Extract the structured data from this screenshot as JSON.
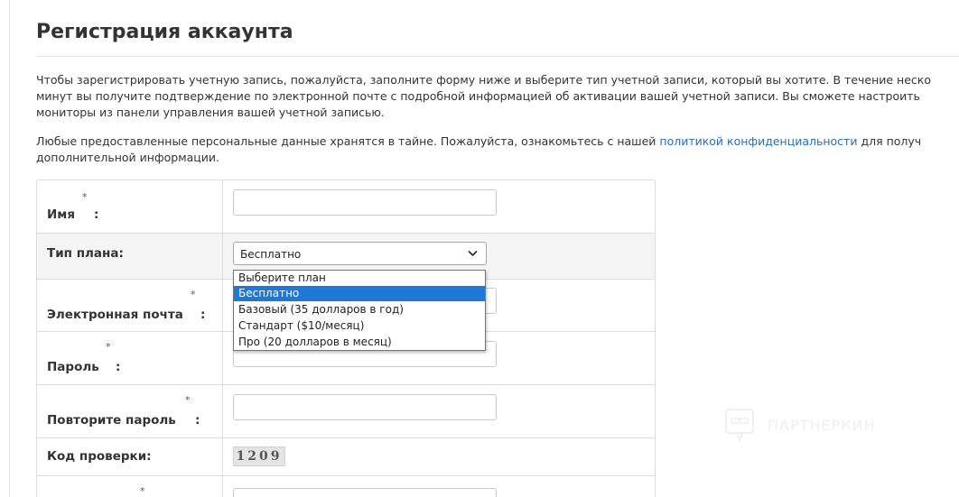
{
  "page": {
    "title": "Регистрация аккаунта",
    "intro_lines": [
      "Чтобы зарегистрировать учетную запись, пожалуйста, заполните форму ниже и выберите тип учетной записи, который вы хотите. В течение неско",
      "минут вы получите подтверждение по электронной почте с подробной информацией об активации вашей учетной записи. Вы сможете настроить",
      "мониторы из панели управления вашей учетной записью."
    ],
    "privacy_before": "Любые предоставленные персональные данные хранятся в тайне. Пожалуйста, ознакомьтесь с нашей ",
    "privacy_link": "политикой конфиденциальности",
    "privacy_after": " для получ",
    "privacy_line2": "дополнительной информации."
  },
  "form": {
    "name_label": "Имя",
    "plan_label": "Тип плана:",
    "email_label": "Электронная почта",
    "password_label": "Пароль",
    "repeat_password_label": "Повторите пароль",
    "captcha_label": "Код проверки:",
    "colon": ":",
    "required_marker": "*",
    "name_value": "",
    "email_value": "",
    "password_value": "",
    "repeat_password_value": "",
    "plan_selected": "Бесплатно",
    "captcha_code": "1209"
  },
  "plan_dropdown": {
    "options": [
      "Выберите план",
      "Бесплатно",
      "Базовый (35 долларов в год)",
      "Стандарт ($10/месяц)",
      "Про (20 долларов в месяц)"
    ],
    "highlighted_index": 1
  },
  "watermark": {
    "text": "ПАРТНЕРКИН"
  },
  "colors": {
    "link": "#2a6db5",
    "selected_option": "#1e78d7",
    "row_alt": "#f5f5f5"
  }
}
